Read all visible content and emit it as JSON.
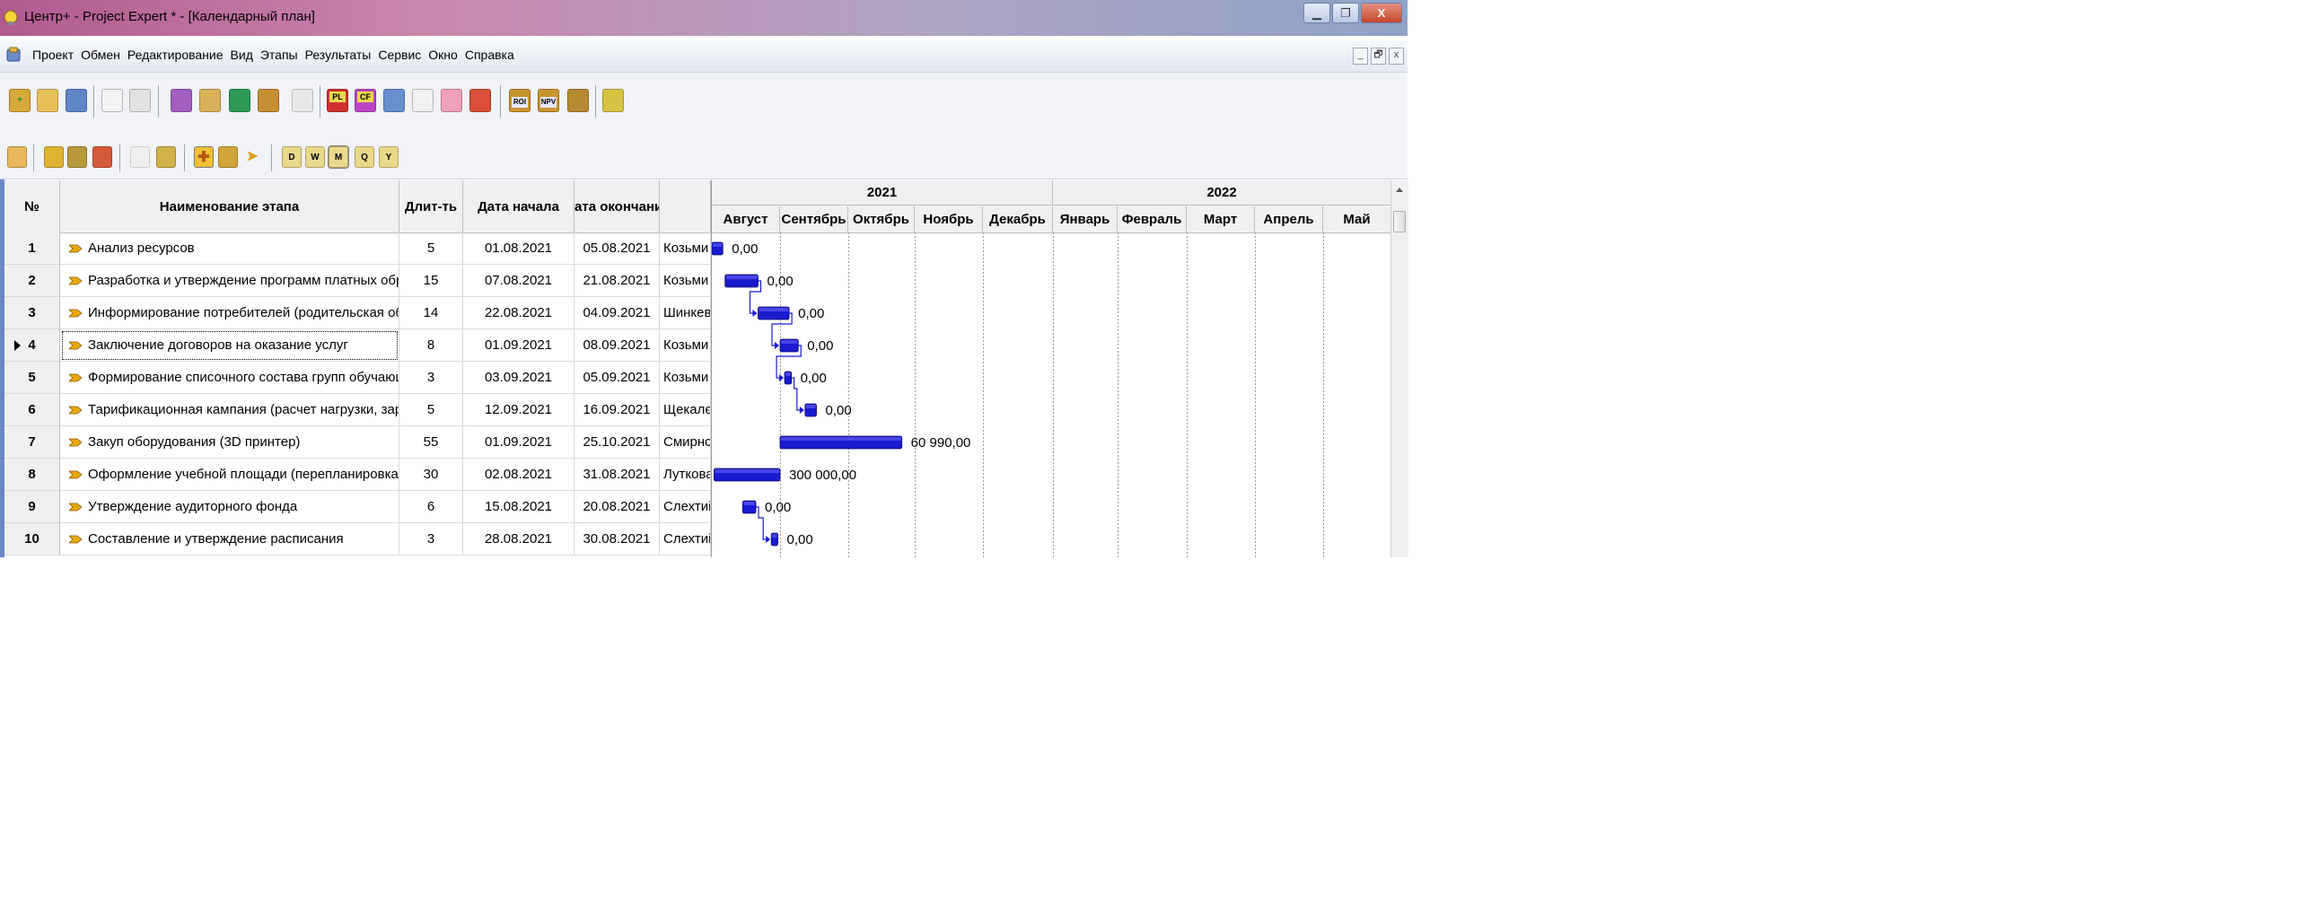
{
  "window": {
    "title": "Центр+ - Project Expert * - [Календарный план]"
  },
  "menu": {
    "items": [
      "Проект",
      "Обмен",
      "Редактирование",
      "Вид",
      "Этапы",
      "Результаты",
      "Сервис",
      "Окно",
      "Справка"
    ]
  },
  "toolbar2_labels": {
    "day": "D",
    "week": "W",
    "month": "M",
    "quarter": "Q",
    "year": "Y"
  },
  "toolbar1_labels": {
    "pl": "PL",
    "cf": "CF",
    "roi": "ROI",
    "npv": "NPV"
  },
  "table": {
    "headers": {
      "num": "№",
      "name": "Наименование этапа",
      "duration": "Длит-ть",
      "start": "Дата начала",
      "end": "ата окончани"
    },
    "rows": [
      {
        "num": "1",
        "name": "Анализ ресурсов",
        "duration": "5",
        "start": "01.08.2021",
        "end": "05.08.2021",
        "resp": "Козьми"
      },
      {
        "num": "2",
        "name": "Разработка и утверждение программ платных образ",
        "duration": "15",
        "start": "07.08.2021",
        "end": "21.08.2021",
        "resp": "Козьми"
      },
      {
        "num": "3",
        "name": "Информирование потребителей (родительская общ",
        "duration": "14",
        "start": "22.08.2021",
        "end": "04.09.2021",
        "resp": "Шинкев"
      },
      {
        "num": "4",
        "name": "Заключение договоров на оказание услуг",
        "duration": "8",
        "start": "01.09.2021",
        "end": "08.09.2021",
        "resp": "Козьми"
      },
      {
        "num": "5",
        "name": "Формирование списочного состава групп обучающихс",
        "duration": "3",
        "start": "03.09.2021",
        "end": "05.09.2021",
        "resp": "Козьми"
      },
      {
        "num": "6",
        "name": "Тарификационная кампания (расчет нагрузки, зараб",
        "duration": "5",
        "start": "12.09.2021",
        "end": "16.09.2021",
        "resp": "Щекалє"
      },
      {
        "num": "7",
        "name": "Закуп оборудования (3D принтер)",
        "duration": "55",
        "start": "01.09.2021",
        "end": "25.10.2021",
        "resp": "Смирнс"
      },
      {
        "num": "8",
        "name": "Оформление учебной площади (перепланировка рег",
        "duration": "30",
        "start": "02.08.2021",
        "end": "31.08.2021",
        "resp": "Луткова"
      },
      {
        "num": "9",
        "name": "Утверждение аудиторного фонда",
        "duration": "6",
        "start": "15.08.2021",
        "end": "20.08.2021",
        "resp": "Слехтиі"
      },
      {
        "num": "10",
        "name": "Составление и утверждение расписания",
        "duration": "3",
        "start": "28.08.2021",
        "end": "30.08.2021",
        "resp": "Слехтиі"
      }
    ],
    "selected_row": 4
  },
  "gantt": {
    "years": [
      "2021",
      "2022"
    ],
    "months": [
      "Август",
      "Сентябрь",
      "Октябрь",
      "Ноябрь",
      "Декабрь",
      "Январь",
      "Февраль",
      "Март",
      "Апрель",
      "Май"
    ],
    "bar_color": "#1a1acf",
    "bars": [
      {
        "start": "2021-08-01",
        "days": 5,
        "label": "0,00"
      },
      {
        "start": "2021-08-07",
        "days": 15,
        "label": "0,00"
      },
      {
        "start": "2021-08-22",
        "days": 14,
        "label": "0,00"
      },
      {
        "start": "2021-09-01",
        "days": 8,
        "label": "0,00"
      },
      {
        "start": "2021-09-03",
        "days": 3,
        "label": "0,00"
      },
      {
        "start": "2021-09-12",
        "days": 5,
        "label": "0,00"
      },
      {
        "start": "2021-09-01",
        "days": 55,
        "label": "60 990,00"
      },
      {
        "start": "2021-08-02",
        "days": 30,
        "label": "300 000,00"
      },
      {
        "start": "2021-08-15",
        "days": 6,
        "label": "0,00"
      },
      {
        "start": "2021-08-28",
        "days": 3,
        "label": "0,00"
      }
    ],
    "links": [
      [
        2,
        3
      ],
      [
        3,
        4
      ],
      [
        4,
        5
      ],
      [
        5,
        6
      ],
      [
        9,
        10
      ]
    ]
  }
}
